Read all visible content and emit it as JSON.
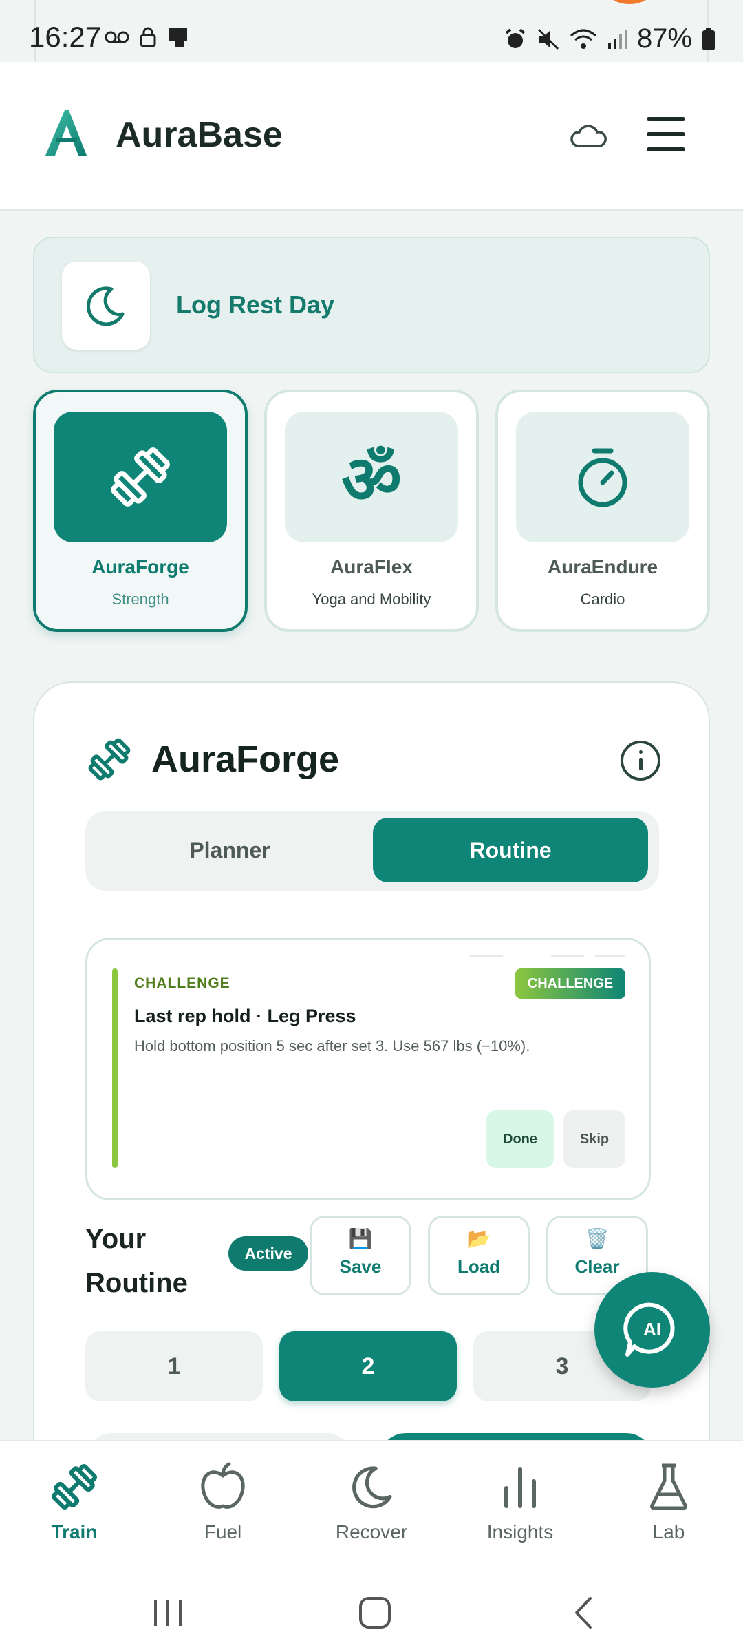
{
  "status_bar": {
    "time": "16:27",
    "battery": "87%"
  },
  "header": {
    "brand": "AuraBase"
  },
  "rest_day": {
    "label": "Log Rest Day"
  },
  "modes": [
    {
      "name": "AuraForge",
      "sub": "Strength",
      "active": true
    },
    {
      "name": "AuraFlex",
      "sub": "Yoga and Mobility",
      "active": false
    },
    {
      "name": "AuraEndure",
      "sub": "Cardio",
      "active": false
    }
  ],
  "panel": {
    "title": "AuraForge",
    "tabs": [
      "Planner",
      "Routine"
    ],
    "active_tab": "Routine"
  },
  "challenge": {
    "tag": "CHALLENGE",
    "badge": "CHALLENGE",
    "title": "Last rep hold · Leg Press",
    "description": "Hold bottom position 5 sec after set 3. Use 567 lbs (−10%).",
    "done_label": "Done",
    "skip_label": "Skip"
  },
  "routine": {
    "title": "Your Routine",
    "status": "Active",
    "actions": [
      {
        "emoji": "💾",
        "label": "Save"
      },
      {
        "emoji": "📂",
        "label": "Load"
      },
      {
        "emoji": "🗑️",
        "label": "Clear"
      }
    ],
    "days": [
      "1",
      "2",
      "3"
    ],
    "active_day": "2"
  },
  "fab": {
    "label": "AI"
  },
  "bottom_nav": [
    {
      "label": "Train",
      "icon": "dumbbell-icon",
      "active": true
    },
    {
      "label": "Fuel",
      "icon": "apple-icon",
      "active": false
    },
    {
      "label": "Recover",
      "icon": "moon-icon",
      "active": false
    },
    {
      "label": "Insights",
      "icon": "bar-chart-icon",
      "active": false
    },
    {
      "label": "Lab",
      "icon": "flask-icon",
      "active": false
    }
  ],
  "colors": {
    "accent": "#0e8576",
    "challenge_green": "#8cc63f",
    "background": "#f0f4f3"
  }
}
